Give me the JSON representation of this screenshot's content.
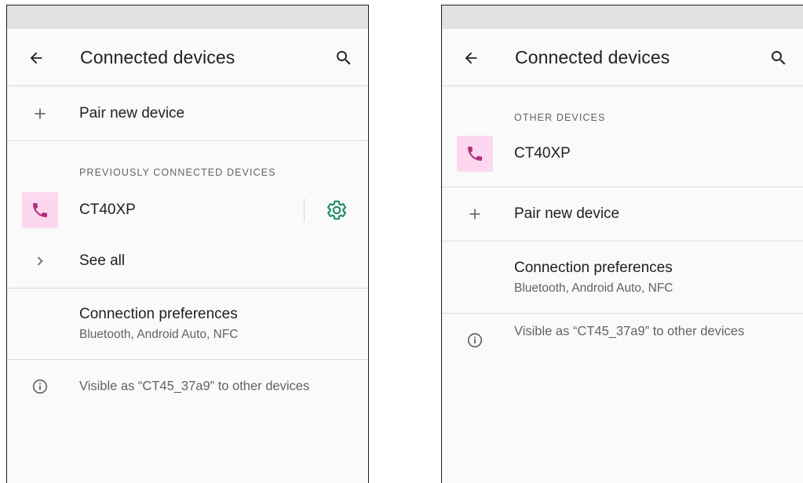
{
  "left": {
    "title": "Connected devices",
    "pair_label": "Pair new device",
    "section_header": "PREVIOUSLY CONNECTED DEVICES",
    "device_name": "CT40XP",
    "see_all_label": "See all",
    "pref_title": "Connection preferences",
    "pref_summary": "Bluetooth, Android Auto, NFC",
    "visible_text": "Visible as “CT45_37a9” to other devices"
  },
  "right": {
    "title": "Connected devices",
    "section_header": "OTHER DEVICES",
    "device_name": "CT40XP",
    "pair_label": "Pair new device",
    "pref_title": "Connection preferences",
    "pref_summary": "Bluetooth, Android Auto, NFC",
    "visible_text": "Visible as “CT45_37a9” to other devices"
  },
  "icons": {
    "back": "arrow-left-icon",
    "search": "magnifier-icon",
    "add": "plus-icon",
    "phone": "phone-icon",
    "settings": "gear-icon",
    "expand": "chevron-right-icon",
    "info": "info-circle-icon"
  },
  "colors": {
    "device_icon_bg": "#fcd7ef",
    "phone_icon": "#b0307c",
    "gear": "#1e8a6e",
    "status_bar": "#e1e1e1",
    "background": "#fafafa"
  }
}
